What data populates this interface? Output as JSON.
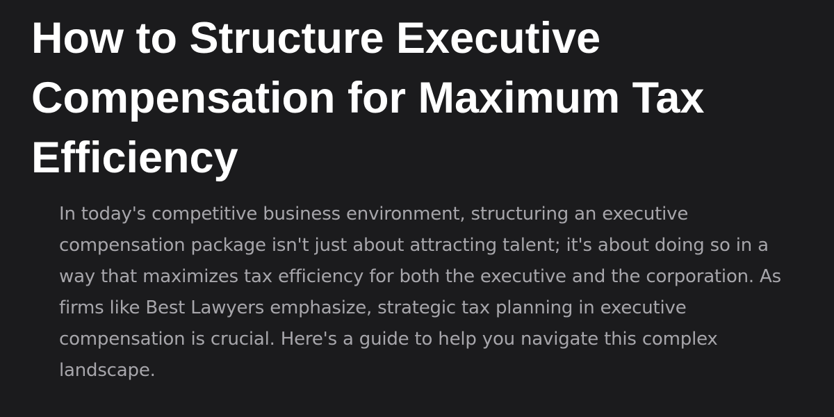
{
  "article": {
    "title": "How to Structure Executive Compensation for Maximum Tax Efficiency",
    "intro": "In today's competitive business environment, structuring an executive compensation package isn't just about attracting talent; it's about doing so in a way that maximizes tax efficiency for both the executive and the corporation. As firms like Best Lawyers emphasize, strategic tax planning in executive compensation is crucial. Here's a guide to help you navigate this complex landscape."
  },
  "colors": {
    "background": "#1b1b1d",
    "title": "#ffffff",
    "body_text": "#a7a6ab"
  }
}
